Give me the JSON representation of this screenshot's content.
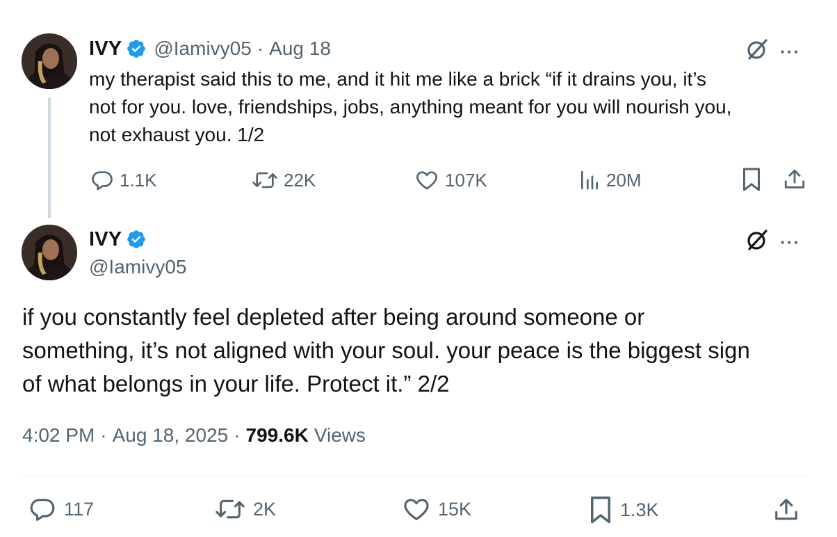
{
  "tweet1": {
    "name": "IVY",
    "handle": "@Iamivy05",
    "date": "Aug 18",
    "text_lines": [
      "my therapist said this to me, and it hit me like a brick “if it drains you, it’s",
      "not for you. love, friendships, jobs, anything meant for you will nourish you,",
      "not exhaust you. 1/2"
    ],
    "actions": {
      "replies": "1.1K",
      "reposts": "22K",
      "likes": "107K",
      "views": "20M"
    },
    "icons": [
      "grok-icon",
      "more-icon",
      "reply-icon",
      "repost-icon",
      "like-icon",
      "views-icon",
      "bookmark-icon",
      "share-icon"
    ]
  },
  "tweet2": {
    "name": "IVY",
    "handle": "@Iamivy05",
    "text_lines": [
      "if you constantly feel depleted after being around someone or",
      "something, it’s not aligned with your soul. your peace is the biggest sign",
      "of what belongs in your life. Protect it.” 2/2"
    ],
    "time": "4:02 PM",
    "full_date": "Aug 18, 2025",
    "views_count": "799.6K",
    "views_label": "Views",
    "actions": {
      "replies": "117",
      "reposts": "2K",
      "likes": "15K",
      "bookmarks": "1.3K"
    }
  },
  "colors": {
    "text": "#0f1419",
    "secondary": "#536471",
    "verified": "#1d9bf0",
    "thread_line": "#cfd9de"
  }
}
